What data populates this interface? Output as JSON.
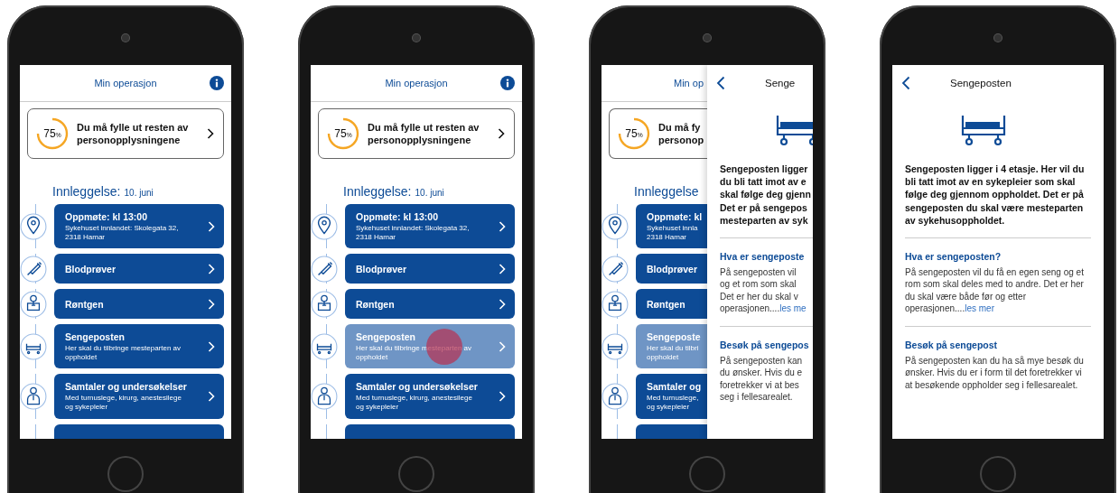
{
  "phones": [
    {
      "layers": [
        {
          "kind": "list",
          "covered": false,
          "title": "Min operasjon",
          "progress": {
            "value": "75",
            "unit": "%",
            "lines": [
              "Du må fylle ut resten av",
              "personopplysningene"
            ]
          },
          "heading": "Innleggelse:",
          "date": "10. juni",
          "items": [
            {
              "title": "Oppmøte: kl 13:00",
              "lines": [
                "Sykehuset innlandet: Skolegata 32,",
                "2318 Hamar"
              ],
              "selected": false,
              "touched": false
            },
            {
              "title": "Blodprøver",
              "selected": false,
              "touched": false
            },
            {
              "title": "Røntgen",
              "selected": false,
              "touched": false
            },
            {
              "title": "Sengeposten",
              "lines": [
                "Her skal du tilbringe mesteparten av",
                "oppholdet"
              ],
              "selected": false,
              "touched": false
            },
            {
              "title": "Samtaler og undersøkelser",
              "lines": [
                "Med turnuslege, kirurg, anestesilege",
                "og sykepleier"
              ],
              "selected": false,
              "touched": false
            }
          ]
        }
      ]
    },
    {
      "layers": [
        {
          "kind": "list",
          "covered": false,
          "title": "Min operasjon",
          "progress": {
            "value": "75",
            "unit": "%",
            "lines": [
              "Du må fylle ut resten av",
              "personopplysningene"
            ]
          },
          "heading": "Innleggelse:",
          "date": "10. juni",
          "items": [
            {
              "title": "Oppmøte: kl 13:00",
              "lines": [
                "Sykehuset innlandet: Skolegata 32,",
                "2318 Hamar"
              ],
              "selected": false,
              "touched": false
            },
            {
              "title": "Blodprøver",
              "selected": false,
              "touched": false
            },
            {
              "title": "Røntgen",
              "selected": false,
              "touched": false
            },
            {
              "title": "Sengeposten",
              "lines": [
                "Her skal du tilbringe mesteparten av",
                "oppholdet"
              ],
              "selected": true,
              "touched": true
            },
            {
              "title": "Samtaler og undersøkelser",
              "lines": [
                "Med turnuslege, kirurg, anestesilege",
                "og sykepleier"
              ],
              "selected": false,
              "touched": false
            }
          ]
        }
      ]
    },
    {
      "layers": [
        {
          "kind": "list",
          "covered": true,
          "title": "Min op",
          "progress": {
            "value": "75",
            "unit": "%",
            "lines": [
              "Du må fy",
              "personop"
            ]
          },
          "heading": "Innleggelse",
          "items": [
            {
              "title": "Oppmøte: kl",
              "lines": [
                "Sykehuset innla",
                "2318 Hamar"
              ],
              "selected": false,
              "touched": false
            },
            {
              "title": "Blodprøver",
              "selected": false,
              "touched": false
            },
            {
              "title": "Røntgen",
              "selected": false,
              "touched": false
            },
            {
              "title": "Sengeposte",
              "lines": [
                "Her skal du tilbri",
                "oppholdet"
              ],
              "selected": true,
              "touched": false
            },
            {
              "title": "Samtaler og",
              "lines": [
                "Med turnuslege,",
                "og sykepleier"
              ],
              "selected": false,
              "touched": false
            }
          ]
        },
        {
          "kind": "detail",
          "title": "Senge",
          "intro": {
            "lines": [
              "Sengeposten ligger",
              "du bli tatt imot av e",
              "skal følge deg gjenn",
              "Det er på sengepos",
              "mesteparten av syk"
            ]
          },
          "sections": [
            {
              "heading": "Hva er sengeposte",
              "lines": [
                "På sengeposten vil",
                "og et rom som skal",
                "Det er her du skal v",
                "operasjonen...."
              ],
              "link": "les me"
            },
            {
              "heading": "Besøk på sengepos",
              "lines": [
                "På sengeposten kan",
                "du ønsker. Hvis du e",
                "foretrekker vi at bes",
                "seg i fellesarealet."
              ]
            }
          ]
        }
      ]
    },
    {
      "layers": [
        {
          "kind": "detail",
          "title": "Sengeposten",
          "intro": {
            "text": "Sengeposten ligger i 4 etasje. Her vil du bli tatt imot av en sykepleier som skal følge deg gjennom oppholdet. Det er på sengeposten du skal være mesteparten av sykehusoppholdet."
          },
          "sections": [
            {
              "heading": "Hva er sengeposten?",
              "text": "På sengeposten vil du få en egen seng og et rom som skal deles med to andre. Det er her du skal være både før og etter operasjonen....",
              "link": "les mer"
            },
            {
              "heading": "Besøk på sengepost",
              "text": "På sengeposten kan du ha så mye besøk du ønsker. Hvis du er i form til det foretrekker vi at besøkende oppholder seg i fellesarealet."
            }
          ]
        }
      ]
    }
  ]
}
